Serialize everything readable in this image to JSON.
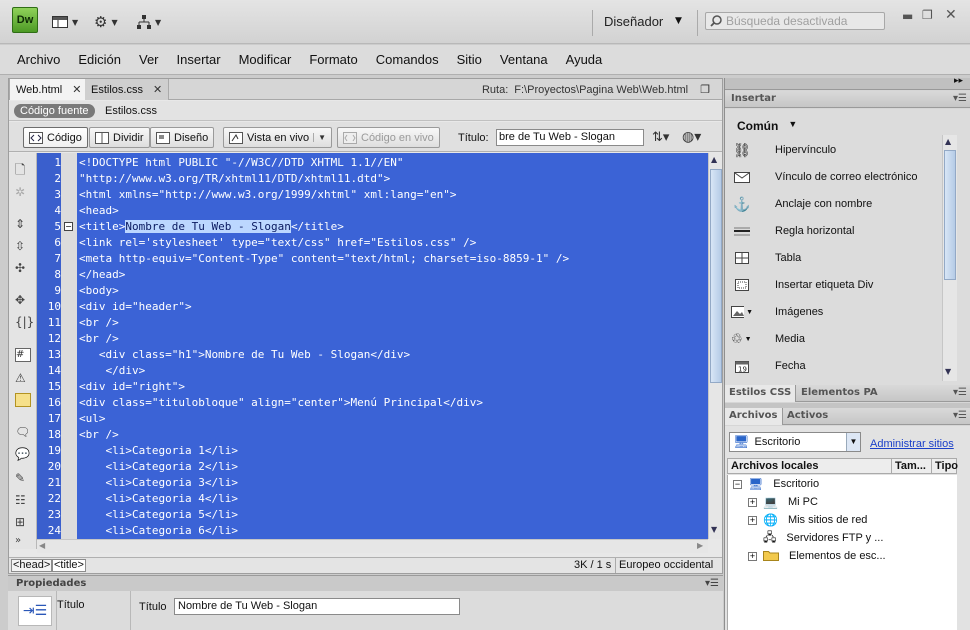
{
  "app": {
    "logo": "Dw",
    "workspace": "Diseñador",
    "search_placeholder": "Búsqueda desactivada"
  },
  "menu": [
    "Archivo",
    "Edición",
    "Ver",
    "Insertar",
    "Modificar",
    "Formato",
    "Comandos",
    "Sitio",
    "Ventana",
    "Ayuda"
  ],
  "doc_tabs": [
    {
      "label": "Web.html",
      "active": true
    },
    {
      "label": "Estilos.css",
      "active": false
    }
  ],
  "path": {
    "label": "Ruta:",
    "value": "F:\\Proyectos\\Pagina Web\\Web.html"
  },
  "related": {
    "source_label": "Código fuente",
    "file": "Estilos.css"
  },
  "view_buttons": {
    "code": "Código",
    "split": "Dividir",
    "design": "Diseño",
    "live": "Vista en vivo",
    "live_code": "Código en vivo"
  },
  "title_field": {
    "label": "Título:",
    "value": "bre de Tu Web - Slogan"
  },
  "code_lines": [
    "<!DOCTYPE html PUBLIC \"-//W3C//DTD XHTML 1.1//EN\"",
    "\"http://www.w3.org/TR/xhtml11/DTD/xhtml11.dtd\">",
    "<html xmlns=\"http://www.w3.org/1999/xhtml\" xml:lang=\"en\">",
    "<head>",
    "<title>Nombre de Tu Web - Slogan</title>",
    "<link rel='stylesheet' type=\"text/css\" href=\"Estilos.css\" />",
    "<meta http-equiv=\"Content-Type\" content=\"text/html; charset=iso-8859-1\" />",
    "</head>",
    "<body>",
    "<div id=\"header\">",
    "<br />",
    "<br />",
    "   <div class=\"h1\">Nombre de Tu Web - Slogan</div>",
    "    </div>",
    "<div id=\"right\">",
    "<div class=\"titulobloque\" align=\"center\">Menú Principal</div>",
    "<ul>",
    "<br />",
    "    <li>Categoria 1</li>",
    "    <li>Categoria 2</li>",
    "    <li>Categoria 3</li>",
    "    <li>Categoria 4</li>",
    "    <li>Categoria 5</li>",
    "    <li>Categoria 6</li>"
  ],
  "selection": {
    "line": 5,
    "text": "Nombre de Tu Web - Slogan"
  },
  "status": {
    "tags": [
      "<head>",
      "<title>"
    ],
    "size": "3K / 1 s",
    "encoding": "Europeo occidental"
  },
  "properties": {
    "header": "Propiedades",
    "section": "Título",
    "field_label": "Título",
    "field_value": "Nombre de Tu Web - Slogan"
  },
  "insert_panel": {
    "header": "Insertar",
    "category": "Común",
    "items": [
      "Hipervínculo",
      "Vínculo de correo electrónico",
      "Anclaje con nombre",
      "Regla horizontal",
      "Tabla",
      "Insertar etiqueta Div",
      "Imágenes",
      "Media",
      "Fecha"
    ]
  },
  "css_panel": {
    "tabs": [
      "Estilos CSS",
      "Elementos PA"
    ]
  },
  "files_panel": {
    "tabs": [
      "Archivos",
      "Activos"
    ],
    "site": "Escritorio",
    "manage_link": "Administrar sitios",
    "columns": [
      "Archivos locales",
      "Tam...",
      "Tipo"
    ],
    "root": "Escritorio",
    "items": [
      "Mi PC",
      "Mis sitios de red",
      "Servidores FTP y ...",
      "Elementos de esc..."
    ]
  },
  "colors": {
    "code_bg": "#3b63d6",
    "gutter": "#3a5fcd",
    "selection": "#bcd7ff",
    "link": "#1a3fc9"
  }
}
